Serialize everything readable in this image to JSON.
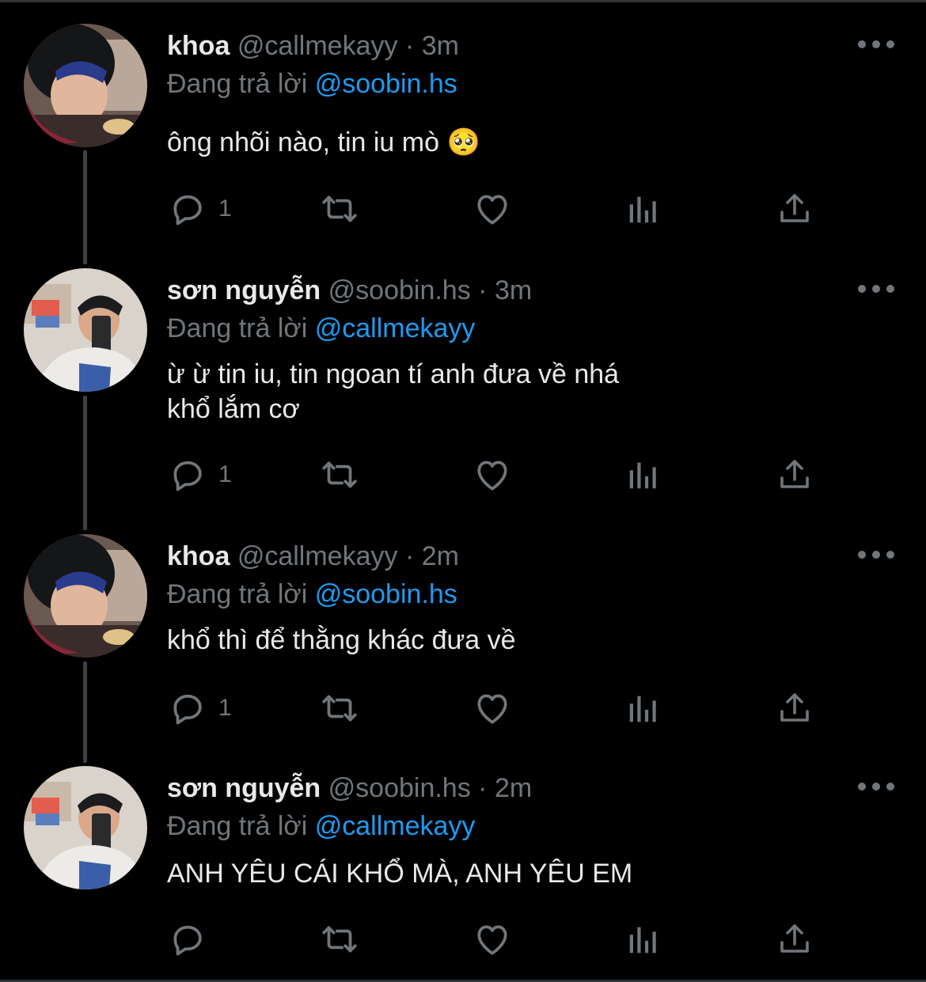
{
  "tweets": [
    {
      "name": "khoa",
      "handle": "@callmekayy",
      "separator": "·",
      "time": "3m",
      "replying_prefix": "Đang trả lời",
      "replying_to": "@soobin.hs",
      "text": "ông nhõi nào, tin iu mò 🥺",
      "reply_count": "1",
      "avatar": "avatar-khoa"
    },
    {
      "name": "sơn nguyễn",
      "handle": "@soobin.hs",
      "separator": "·",
      "time": "3m",
      "replying_prefix": "Đang trả lời",
      "replying_to": "@callmekayy",
      "text": "ừ ừ tin iu, tin ngoan tí anh đưa về nhá\nkhổ lắm cơ",
      "reply_count": "1",
      "avatar": "avatar-son"
    },
    {
      "name": "khoa",
      "handle": "@callmekayy",
      "separator": "·",
      "time": "2m",
      "replying_prefix": "Đang trả lời",
      "replying_to": "@soobin.hs",
      "text": "khổ thì để thằng khác đưa về",
      "reply_count": "1",
      "avatar": "avatar-khoa"
    },
    {
      "name": "sơn nguyễn",
      "handle": "@soobin.hs",
      "separator": "·",
      "time": "2m",
      "replying_prefix": "Đang trả lời",
      "replying_to": "@callmekayy",
      "text": "ANH YÊU CÁI KHỔ MÀ, ANH YÊU EM",
      "reply_count": "",
      "avatar": "avatar-son"
    }
  ],
  "icons": [
    "reply-icon",
    "retweet-icon",
    "like-icon",
    "views-icon",
    "share-icon",
    "more-icon"
  ],
  "colors": {
    "background": "#000000",
    "text": "#e7e9ea",
    "muted": "#71767b",
    "mention": "#1d9bf0",
    "thread_line": "#3e4144"
  }
}
